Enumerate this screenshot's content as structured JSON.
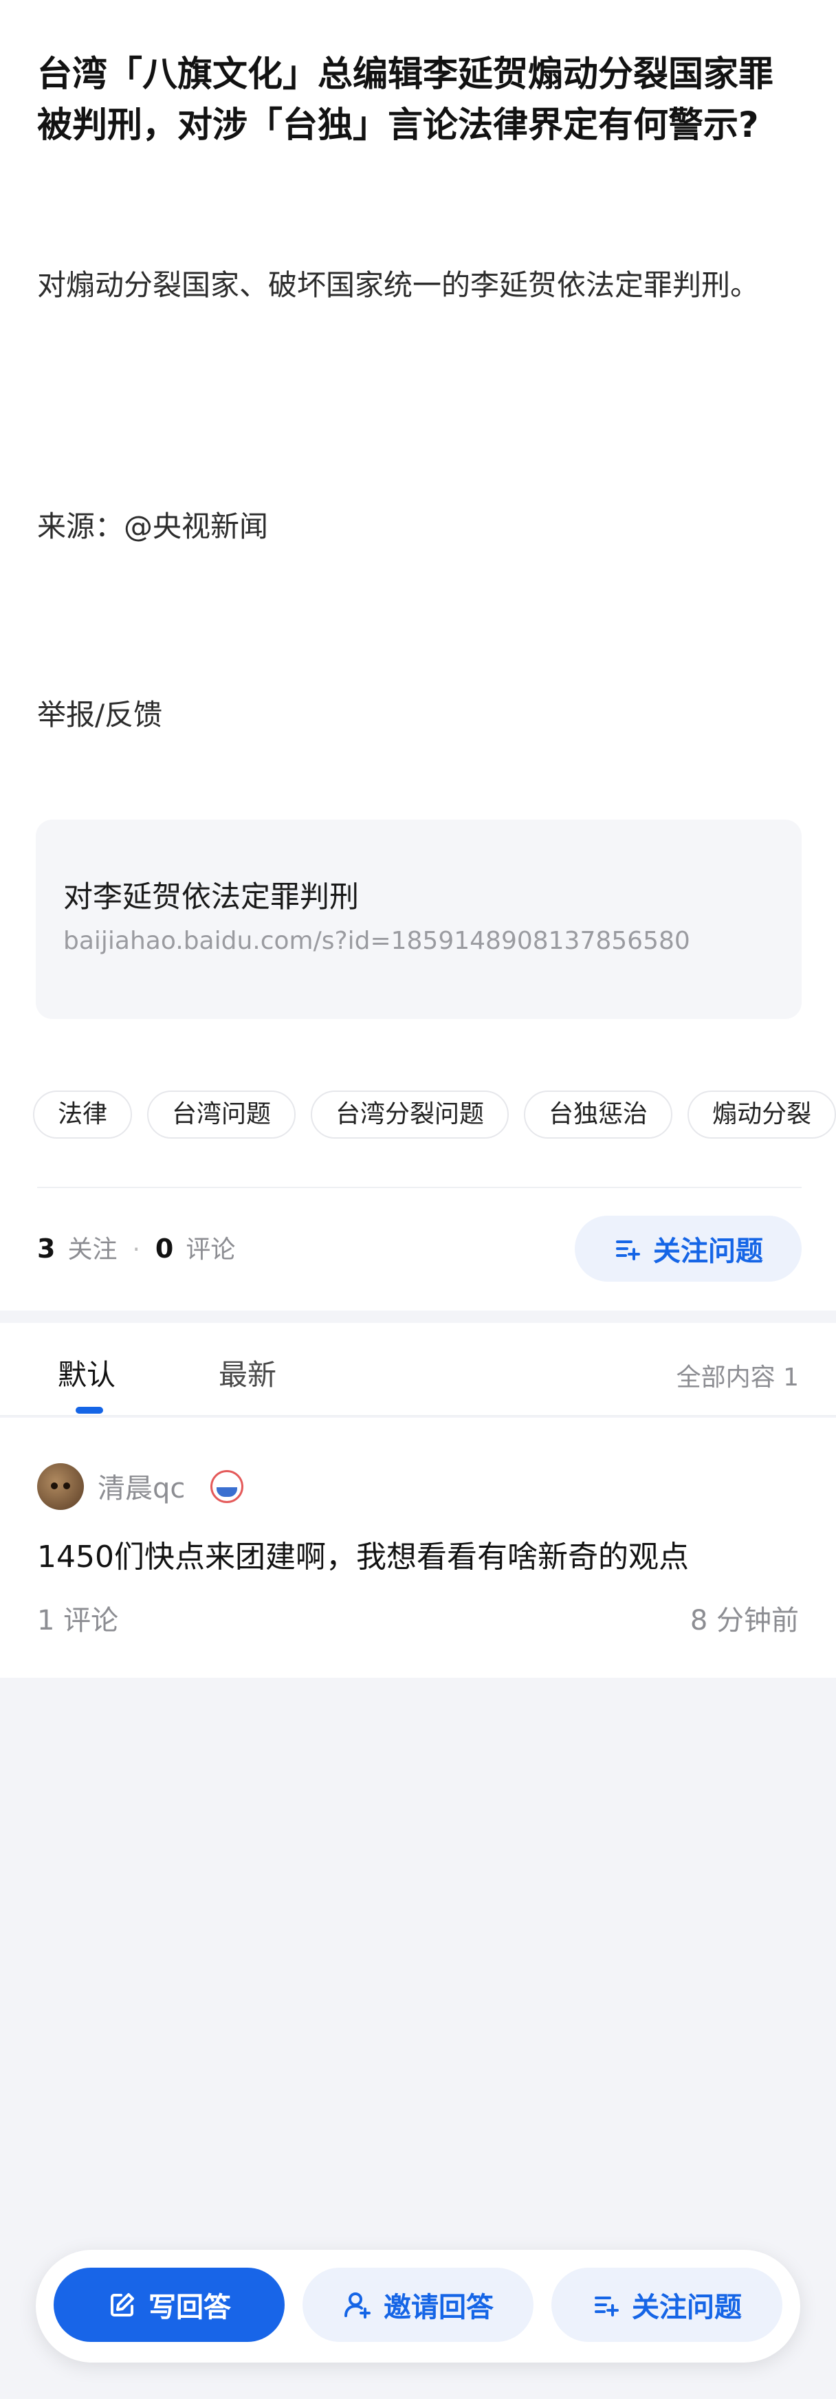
{
  "question": {
    "title": "台湾「八旗文化」总编辑李延贺煽动分裂国家罪被判刑，对涉「台独」言论法律界定有何警示?",
    "body": "对煽动分裂国家、破坏国家统一的李延贺依法定罪判刑。",
    "source": "来源：@央视新闻",
    "report": "举报/反馈"
  },
  "link_card": {
    "title": "对李延贺依法定罪判刑",
    "url": "baijiahao.baidu.com/s?id=1859148908137856580"
  },
  "tags": [
    "法律",
    "台湾问题",
    "台湾分裂问题",
    "台独惩治",
    "煽动分裂"
  ],
  "stats": {
    "follow_count": "3",
    "follow_label": "关注",
    "comment_count": "0",
    "comment_label": "评论",
    "follow_button": "关注问题"
  },
  "tabs": {
    "default": "默认",
    "latest": "最新",
    "all_count": "全部内容 1"
  },
  "answer": {
    "author": "清晨qc",
    "text": "1450们快点来团建啊，我想看看有啥新奇的观点",
    "comments": "1 评论",
    "time": "8 分钟前"
  },
  "bottom_bar": {
    "write": "写回答",
    "invite": "邀请回答",
    "follow": "关注问题"
  },
  "colors": {
    "accent": "#1565e6",
    "accent_soft": "#edf2fc",
    "page_bg": "#f3f4f8",
    "muted_text": "#8c8d92"
  },
  "icons": [
    "edit-icon",
    "invite-user-icon",
    "follow-list-icon"
  ]
}
